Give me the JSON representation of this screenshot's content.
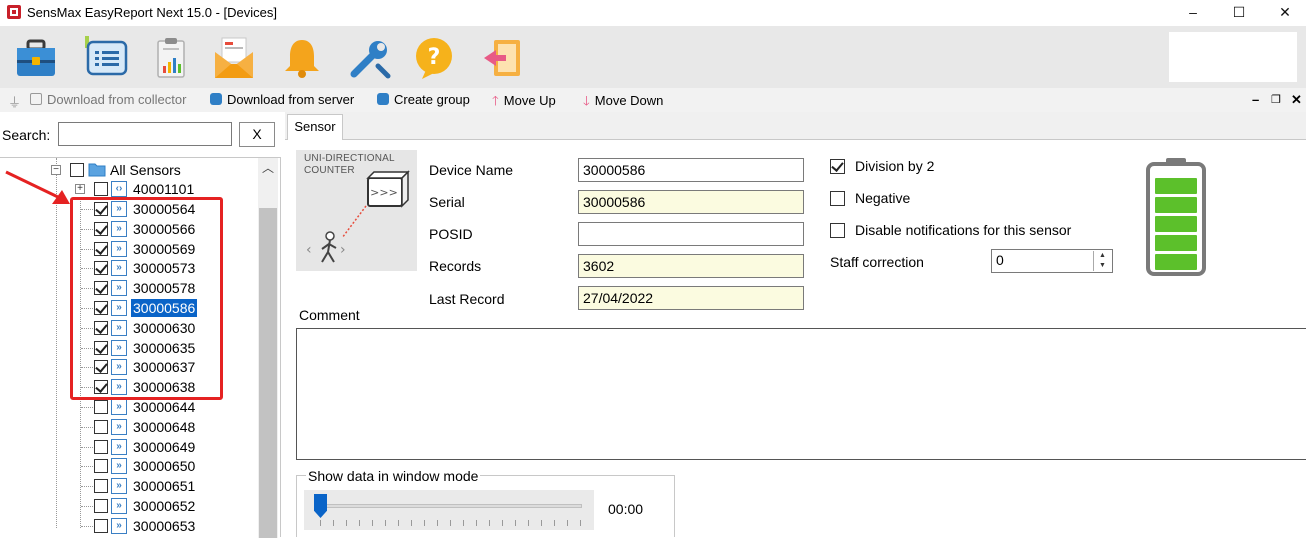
{
  "window": {
    "title": "SensMax EasyReport Next 15.0  - [Devices]",
    "minimize_glyph": "–",
    "maximize_glyph": "☐",
    "close_glyph": "✕"
  },
  "toolbar_icons": [
    "briefcase-icon",
    "list-window-icon",
    "clipboard-chart-icon",
    "report-envelope-icon",
    "bell-icon",
    "wrench-icon",
    "help-icon",
    "exit-icon"
  ],
  "action_bar": {
    "download_collector": "Download from collector",
    "download_server": "Download from server",
    "create_group": "Create group",
    "move_up": "Move Up",
    "move_down": "Move Down",
    "mdi_min": "–",
    "mdi_restore": "❐",
    "mdi_close": "✕"
  },
  "search": {
    "label": "Search:",
    "value": "",
    "clear_label": "X"
  },
  "tree": {
    "root_label": "All Sensors",
    "group_label": "40001101",
    "items": [
      {
        "label": "30000564",
        "checked": true
      },
      {
        "label": "30000566",
        "checked": true
      },
      {
        "label": "30000569",
        "checked": true
      },
      {
        "label": "30000573",
        "checked": true
      },
      {
        "label": "30000578",
        "checked": true
      },
      {
        "label": "30000586",
        "checked": true,
        "selected": true
      },
      {
        "label": "30000630",
        "checked": true
      },
      {
        "label": "30000635",
        "checked": true
      },
      {
        "label": "30000637",
        "checked": true
      },
      {
        "label": "30000638",
        "checked": true
      },
      {
        "label": "30000644",
        "checked": false
      },
      {
        "label": "30000648",
        "checked": false
      },
      {
        "label": "30000649",
        "checked": false
      },
      {
        "label": "30000650",
        "checked": false
      },
      {
        "label": "30000651",
        "checked": false
      },
      {
        "label": "30000652",
        "checked": false
      },
      {
        "label": "30000653",
        "checked": false
      }
    ]
  },
  "tab": {
    "label": "Sensor"
  },
  "sensor_image": {
    "line1": "UNI-DIRECTIONAL",
    "line2": "COUNTER"
  },
  "fields": {
    "device_name_label": "Device Name",
    "device_name_value": "30000586",
    "serial_label": "Serial",
    "serial_value": "30000586",
    "posid_label": "POSID",
    "posid_value": "",
    "records_label": "Records",
    "records_value": "3602",
    "last_record_label": "Last Record",
    "last_record_value": "27/04/2022"
  },
  "options": {
    "division_label": "Division by 2",
    "division_checked": true,
    "negative_label": "Negative",
    "negative_checked": false,
    "disable_notif_label": "Disable notifications for this sensor",
    "disable_notif_checked": false,
    "staff_label": "Staff correction",
    "staff_value": "0"
  },
  "battery": {
    "level": 1.0,
    "color": "#5cc02b"
  },
  "comment": {
    "label": "Comment",
    "value": ""
  },
  "window_mode": {
    "label": "Show data in window mode",
    "time": "00:00"
  },
  "colors": {
    "highlight": "#e52222",
    "selection": "#0a64c8"
  }
}
